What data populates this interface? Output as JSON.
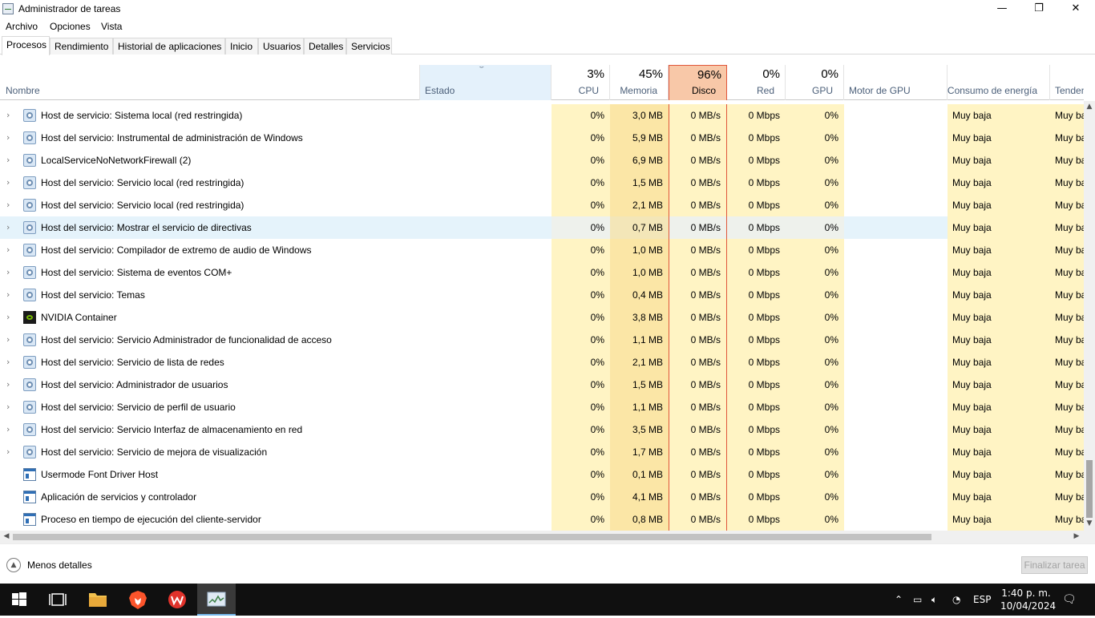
{
  "window": {
    "title": "Administrador de tareas",
    "minimize": "—",
    "restore": "❐",
    "close": "✕"
  },
  "menu": [
    "Archivo",
    "Opciones",
    "Vista"
  ],
  "tabs": [
    "Procesos",
    "Rendimiento",
    "Historial de aplicaciones",
    "Inicio",
    "Usuarios",
    "Detalles",
    "Servicios"
  ],
  "columns": {
    "name": "Nombre",
    "status": "Estado",
    "cpu": {
      "pct": "3%",
      "label": "CPU"
    },
    "memory": {
      "pct": "45%",
      "label": "Memoria"
    },
    "disk": {
      "pct": "96%",
      "label": "Disco"
    },
    "network": {
      "pct": "0%",
      "label": "Red"
    },
    "gpu": {
      "pct": "0%",
      "label": "GPU"
    },
    "gpu_engine": "Motor de GPU",
    "power": "Consumo de energía",
    "power_trend": "Tendenci"
  },
  "processes": [
    {
      "name": "Host de servicio: Sistema local (red restringida)",
      "icon": "gear",
      "expand": true,
      "cpu": "0%",
      "mem": "3,0 MB",
      "disk": "0 MB/s",
      "net": "0 Mbps",
      "gpu": "0%",
      "power": "Muy baja",
      "trend": "Muy baja"
    },
    {
      "name": "Host del servicio: Instrumental de administración de Windows",
      "icon": "gear",
      "expand": true,
      "cpu": "0%",
      "mem": "5,9 MB",
      "disk": "0 MB/s",
      "net": "0 Mbps",
      "gpu": "0%",
      "power": "Muy baja",
      "trend": "Muy baja"
    },
    {
      "name": "LocalServiceNoNetworkFirewall (2)",
      "icon": "gear",
      "expand": true,
      "cpu": "0%",
      "mem": "6,9 MB",
      "disk": "0 MB/s",
      "net": "0 Mbps",
      "gpu": "0%",
      "power": "Muy baja",
      "trend": "Muy baja"
    },
    {
      "name": "Host del servicio: Servicio local (red restringida)",
      "icon": "gear",
      "expand": true,
      "cpu": "0%",
      "mem": "1,5 MB",
      "disk": "0 MB/s",
      "net": "0 Mbps",
      "gpu": "0%",
      "power": "Muy baja",
      "trend": "Muy baja"
    },
    {
      "name": "Host del servicio: Servicio local (red restringida)",
      "icon": "gear",
      "expand": true,
      "cpu": "0%",
      "mem": "2,1 MB",
      "disk": "0 MB/s",
      "net": "0 Mbps",
      "gpu": "0%",
      "power": "Muy baja",
      "trend": "Muy baja"
    },
    {
      "name": "Host del servicio: Mostrar el servicio de directivas",
      "icon": "gear",
      "expand": true,
      "cpu": "0%",
      "mem": "0,7 MB",
      "disk": "0 MB/s",
      "net": "0 Mbps",
      "gpu": "0%",
      "power": "Muy baja",
      "trend": "Muy baja",
      "hover": true
    },
    {
      "name": "Host del servicio: Compilador de extremo de audio de Windows",
      "icon": "gear",
      "expand": true,
      "cpu": "0%",
      "mem": "1,0 MB",
      "disk": "0 MB/s",
      "net": "0 Mbps",
      "gpu": "0%",
      "power": "Muy baja",
      "trend": "Muy baja"
    },
    {
      "name": "Host del servicio: Sistema de eventos COM+",
      "icon": "gear",
      "expand": true,
      "cpu": "0%",
      "mem": "1,0 MB",
      "disk": "0 MB/s",
      "net": "0 Mbps",
      "gpu": "0%",
      "power": "Muy baja",
      "trend": "Muy baja"
    },
    {
      "name": "Host del servicio: Temas",
      "icon": "gear",
      "expand": true,
      "cpu": "0%",
      "mem": "0,4 MB",
      "disk": "0 MB/s",
      "net": "0 Mbps",
      "gpu": "0%",
      "power": "Muy baja",
      "trend": "Muy baja"
    },
    {
      "name": "NVIDIA Container",
      "icon": "nvidia",
      "expand": true,
      "cpu": "0%",
      "mem": "3,8 MB",
      "disk": "0 MB/s",
      "net": "0 Mbps",
      "gpu": "0%",
      "power": "Muy baja",
      "trend": "Muy baja"
    },
    {
      "name": "Host del servicio: Servicio Administrador de funcionalidad de acceso",
      "icon": "gear",
      "expand": true,
      "cpu": "0%",
      "mem": "1,1 MB",
      "disk": "0 MB/s",
      "net": "0 Mbps",
      "gpu": "0%",
      "power": "Muy baja",
      "trend": "Muy baja"
    },
    {
      "name": "Host del servicio: Servicio de lista de redes",
      "icon": "gear",
      "expand": true,
      "cpu": "0%",
      "mem": "2,1 MB",
      "disk": "0 MB/s",
      "net": "0 Mbps",
      "gpu": "0%",
      "power": "Muy baja",
      "trend": "Muy baja"
    },
    {
      "name": "Host del servicio: Administrador de usuarios",
      "icon": "gear",
      "expand": true,
      "cpu": "0%",
      "mem": "1,5 MB",
      "disk": "0 MB/s",
      "net": "0 Mbps",
      "gpu": "0%",
      "power": "Muy baja",
      "trend": "Muy baja"
    },
    {
      "name": "Host del servicio: Servicio de perfil de usuario",
      "icon": "gear",
      "expand": true,
      "cpu": "0%",
      "mem": "1,1 MB",
      "disk": "0 MB/s",
      "net": "0 Mbps",
      "gpu": "0%",
      "power": "Muy baja",
      "trend": "Muy baja"
    },
    {
      "name": "Host del servicio: Servicio Interfaz de almacenamiento en red",
      "icon": "gear",
      "expand": true,
      "cpu": "0%",
      "mem": "3,5 MB",
      "disk": "0 MB/s",
      "net": "0 Mbps",
      "gpu": "0%",
      "power": "Muy baja",
      "trend": "Muy baja"
    },
    {
      "name": "Host del servicio: Servicio de mejora de visualización",
      "icon": "gear",
      "expand": true,
      "cpu": "0%",
      "mem": "1,7 MB",
      "disk": "0 MB/s",
      "net": "0 Mbps",
      "gpu": "0%",
      "power": "Muy baja",
      "trend": "Muy baja"
    },
    {
      "name": "Usermode Font Driver Host",
      "icon": "winapp",
      "expand": false,
      "cpu": "0%",
      "mem": "0,1 MB",
      "disk": "0 MB/s",
      "net": "0 Mbps",
      "gpu": "0%",
      "power": "Muy baja",
      "trend": "Muy baja"
    },
    {
      "name": "Aplicación de servicios y controlador",
      "icon": "winapp",
      "expand": false,
      "cpu": "0%",
      "mem": "4,1 MB",
      "disk": "0 MB/s",
      "net": "0 Mbps",
      "gpu": "0%",
      "power": "Muy baja",
      "trend": "Muy baja"
    },
    {
      "name": "Proceso en tiempo de ejecución del cliente-servidor",
      "icon": "winapp",
      "expand": false,
      "cpu": "0%",
      "mem": "0,8 MB",
      "disk": "0 MB/s",
      "net": "0 Mbps",
      "gpu": "0%",
      "power": "Muy baja",
      "trend": "Muy baja"
    }
  ],
  "footer": {
    "less_details": "Menos detalles",
    "end_task": "Finalizar tarea"
  },
  "taskbar": {
    "language": "ESP",
    "time": "1:40 p. m.",
    "date": "10/04/2024"
  },
  "colors": {
    "heat_light": "#fff4c4",
    "heat_mid": "#fbe6a6",
    "disk_header": "#f8c8a8",
    "disk_border": "#e0563b",
    "hover_row": "#e5f3fb",
    "status_header": "#e4f1fb"
  }
}
